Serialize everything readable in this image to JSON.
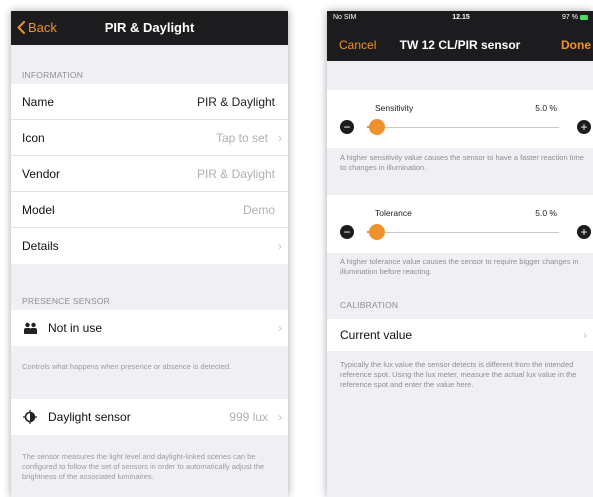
{
  "left": {
    "nav": {
      "back_label": "Back",
      "title": "PIR & Daylight"
    },
    "information": {
      "header": "INFORMATION",
      "rows": [
        {
          "label": "Name",
          "value": "PIR & Daylight"
        },
        {
          "label": "Icon",
          "value": "Tap to set"
        },
        {
          "label": "Vendor",
          "value": "PIR & Daylight"
        },
        {
          "label": "Model",
          "value": "Demo"
        },
        {
          "label": "Details",
          "value": ""
        }
      ]
    },
    "presence": {
      "header": "PRESENCE SENSOR",
      "label": "Not in use",
      "note": "Controls what happens when presence or absence is detected."
    },
    "daylight": {
      "label": "Daylight sensor",
      "value": "999 lux",
      "note": "The sensor measures the light level and daylight-linked scenes can be configured to follow the set of sensors in order to automatically adjust the brightness of the associated luminaires."
    },
    "icons": {
      "back": "chevron-left-icon",
      "presence": "people-icon",
      "daylight": "daylight-half-sun-icon"
    }
  },
  "right": {
    "status": {
      "carrier": "No SIM",
      "time": "12.15",
      "battery": "97 %"
    },
    "nav": {
      "cancel_label": "Cancel",
      "title": "TW 12 CL/PIR sensor",
      "done_label": "Done"
    },
    "sensitivity": {
      "label": "Sensitivity",
      "value_text": "5.0 %",
      "value": 5.0,
      "note": "A higher sensitivity value causes the sensor to have a faster reaction time to changes in illumination."
    },
    "tolerance": {
      "label": "Tolerance",
      "value_text": "5.0 %",
      "value": 5.0,
      "note": "A higher tolerance value causes the sensor to require bigger changes in illumination before reacting."
    },
    "calibration": {
      "header": "CALIBRATION",
      "label": "Current value",
      "note": "Typically the lux value the sensor detects is different from the intended reference spot. Using the lux meter, measure the actual lux value in the reference spot and enter the value here."
    },
    "stepper": {
      "minus": "−",
      "plus": "+"
    }
  },
  "colors": {
    "accent": "#f0922c",
    "navbar": "#1c1c1e",
    "background": "#efeff4"
  }
}
